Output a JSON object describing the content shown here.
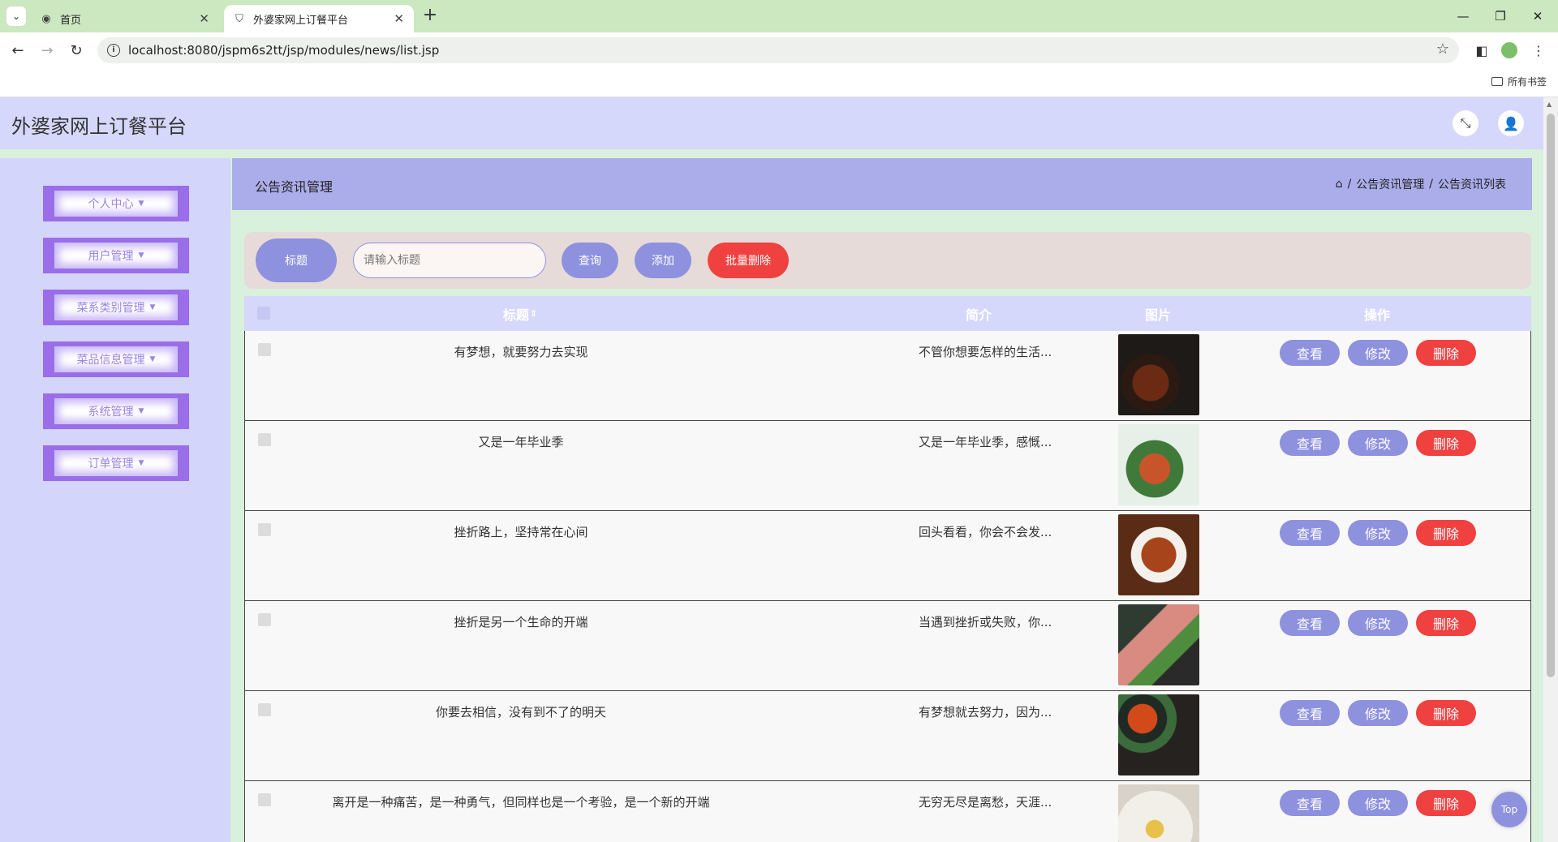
{
  "browser": {
    "tabs": [
      {
        "label": "首页",
        "icon": "globe-icon"
      },
      {
        "label": "外婆家网上订餐平台",
        "icon": "shield-icon"
      }
    ],
    "url": "localhost:8080/jspm6s2tt/jsp/modules/news/list.jsp",
    "bookmarks_label": "所有书签"
  },
  "header": {
    "title": "外婆家网上订餐平台"
  },
  "sidebar": {
    "items": [
      {
        "label": "个人中心"
      },
      {
        "label": "用户管理"
      },
      {
        "label": "菜系类别管理"
      },
      {
        "label": "菜品信息管理"
      },
      {
        "label": "系统管理"
      },
      {
        "label": "订单管理"
      }
    ]
  },
  "content": {
    "title": "公告资讯管理",
    "breadcrumb": [
      "公告资讯管理",
      "公告资讯列表"
    ],
    "breadcrumb_sep": "/"
  },
  "search": {
    "label": "标题",
    "placeholder": "请输入标题",
    "query_button": "查询",
    "add_button": "添加",
    "batch_delete_button": "批量删除"
  },
  "table": {
    "columns": {
      "title": "标题",
      "intro": "简介",
      "image": "图片",
      "actions": "操作"
    },
    "action_labels": {
      "view": "查看",
      "edit": "修改",
      "delete": "删除"
    },
    "rows": [
      {
        "title": "有梦想，就要努力去实现",
        "intro": "不管你想要怎样的生活..."
      },
      {
        "title": "又是一年毕业季",
        "intro": "又是一年毕业季，感慨..."
      },
      {
        "title": "挫折路上，坚持常在心间",
        "intro": "回头看看，你会不会发..."
      },
      {
        "title": "挫折是另一个生命的开端",
        "intro": "当遇到挫折或失败，你..."
      },
      {
        "title": "你要去相信，没有到不了的明天",
        "intro": "有梦想就去努力，因为..."
      },
      {
        "title": "离开是一种痛苦，是一种勇气，但同样也是一个考验，是一个新的开端",
        "intro": "无穷无尽是离愁，天涯..."
      }
    ]
  },
  "top_button": "Top",
  "colors": {
    "header_bg": "#d5d8fb",
    "accent": "#8e91de",
    "danger": "#f04141",
    "menu_border": "#9a6ee8"
  }
}
